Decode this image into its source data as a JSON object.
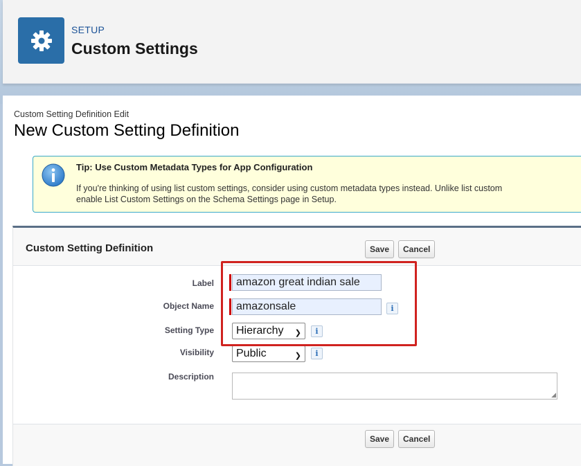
{
  "header": {
    "setup_label": "SETUP",
    "title": "Custom Settings",
    "icon": "gear-icon"
  },
  "page": {
    "breadcrumb": "Custom Setting Definition Edit",
    "title": "New Custom Setting Definition"
  },
  "tip": {
    "icon": "info-icon",
    "title": "Tip: Use Custom Metadata Types for App Configuration",
    "line1": "If you're thinking of using list custom settings, consider using custom metadata types instead. Unlike list custom",
    "line2": "enable List Custom Settings on the Schema Settings page in Setup."
  },
  "panel": {
    "title": "Custom Setting Definition",
    "save_label": "Save",
    "cancel_label": "Cancel"
  },
  "form": {
    "label": {
      "label": "Label",
      "value": "amazon great indian sale"
    },
    "object_name": {
      "label": "Object Name",
      "value": "amazonsale"
    },
    "setting_type": {
      "label": "Setting Type",
      "value": "Hierarchy"
    },
    "visibility": {
      "label": "Visibility",
      "value": "Public"
    },
    "description": {
      "label": "Description",
      "value": ""
    },
    "info_glyph": "i"
  },
  "colors": {
    "header_icon_bg": "#2a6ea8",
    "required_bar": "#cc0000",
    "highlight_box": "#d0221f",
    "tip_bg": "#ffffdc"
  }
}
